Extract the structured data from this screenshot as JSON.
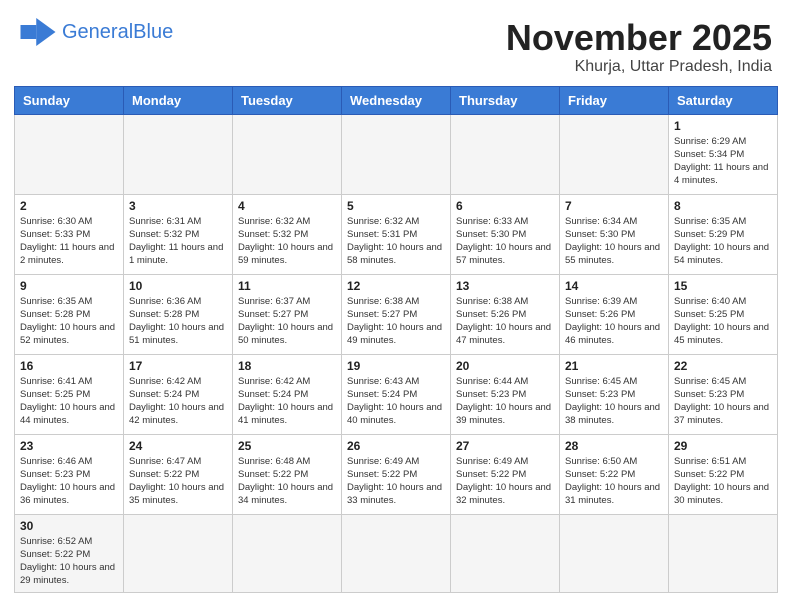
{
  "header": {
    "logo_general": "General",
    "logo_blue": "Blue",
    "month": "November 2025",
    "location": "Khurja, Uttar Pradesh, India"
  },
  "days_of_week": [
    "Sunday",
    "Monday",
    "Tuesday",
    "Wednesday",
    "Thursday",
    "Friday",
    "Saturday"
  ],
  "weeks": [
    [
      {
        "day": "",
        "empty": true
      },
      {
        "day": "",
        "empty": true
      },
      {
        "day": "",
        "empty": true
      },
      {
        "day": "",
        "empty": true
      },
      {
        "day": "",
        "empty": true
      },
      {
        "day": "",
        "empty": true
      },
      {
        "day": "1",
        "sunrise": "6:29 AM",
        "sunset": "5:34 PM",
        "daylight": "11 hours and 4 minutes."
      }
    ],
    [
      {
        "day": "2",
        "sunrise": "6:30 AM",
        "sunset": "5:33 PM",
        "daylight": "11 hours and 2 minutes."
      },
      {
        "day": "3",
        "sunrise": "6:31 AM",
        "sunset": "5:32 PM",
        "daylight": "11 hours and 1 minute."
      },
      {
        "day": "4",
        "sunrise": "6:32 AM",
        "sunset": "5:32 PM",
        "daylight": "10 hours and 59 minutes."
      },
      {
        "day": "5",
        "sunrise": "6:32 AM",
        "sunset": "5:31 PM",
        "daylight": "10 hours and 58 minutes."
      },
      {
        "day": "6",
        "sunrise": "6:33 AM",
        "sunset": "5:30 PM",
        "daylight": "10 hours and 57 minutes."
      },
      {
        "day": "7",
        "sunrise": "6:34 AM",
        "sunset": "5:30 PM",
        "daylight": "10 hours and 55 minutes."
      },
      {
        "day": "8",
        "sunrise": "6:35 AM",
        "sunset": "5:29 PM",
        "daylight": "10 hours and 54 minutes."
      }
    ],
    [
      {
        "day": "9",
        "sunrise": "6:35 AM",
        "sunset": "5:28 PM",
        "daylight": "10 hours and 52 minutes."
      },
      {
        "day": "10",
        "sunrise": "6:36 AM",
        "sunset": "5:28 PM",
        "daylight": "10 hours and 51 minutes."
      },
      {
        "day": "11",
        "sunrise": "6:37 AM",
        "sunset": "5:27 PM",
        "daylight": "10 hours and 50 minutes."
      },
      {
        "day": "12",
        "sunrise": "6:38 AM",
        "sunset": "5:27 PM",
        "daylight": "10 hours and 49 minutes."
      },
      {
        "day": "13",
        "sunrise": "6:38 AM",
        "sunset": "5:26 PM",
        "daylight": "10 hours and 47 minutes."
      },
      {
        "day": "14",
        "sunrise": "6:39 AM",
        "sunset": "5:26 PM",
        "daylight": "10 hours and 46 minutes."
      },
      {
        "day": "15",
        "sunrise": "6:40 AM",
        "sunset": "5:25 PM",
        "daylight": "10 hours and 45 minutes."
      }
    ],
    [
      {
        "day": "16",
        "sunrise": "6:41 AM",
        "sunset": "5:25 PM",
        "daylight": "10 hours and 44 minutes."
      },
      {
        "day": "17",
        "sunrise": "6:42 AM",
        "sunset": "5:24 PM",
        "daylight": "10 hours and 42 minutes."
      },
      {
        "day": "18",
        "sunrise": "6:42 AM",
        "sunset": "5:24 PM",
        "daylight": "10 hours and 41 minutes."
      },
      {
        "day": "19",
        "sunrise": "6:43 AM",
        "sunset": "5:24 PM",
        "daylight": "10 hours and 40 minutes."
      },
      {
        "day": "20",
        "sunrise": "6:44 AM",
        "sunset": "5:23 PM",
        "daylight": "10 hours and 39 minutes."
      },
      {
        "day": "21",
        "sunrise": "6:45 AM",
        "sunset": "5:23 PM",
        "daylight": "10 hours and 38 minutes."
      },
      {
        "day": "22",
        "sunrise": "6:45 AM",
        "sunset": "5:23 PM",
        "daylight": "10 hours and 37 minutes."
      }
    ],
    [
      {
        "day": "23",
        "sunrise": "6:46 AM",
        "sunset": "5:23 PM",
        "daylight": "10 hours and 36 minutes."
      },
      {
        "day": "24",
        "sunrise": "6:47 AM",
        "sunset": "5:22 PM",
        "daylight": "10 hours and 35 minutes."
      },
      {
        "day": "25",
        "sunrise": "6:48 AM",
        "sunset": "5:22 PM",
        "daylight": "10 hours and 34 minutes."
      },
      {
        "day": "26",
        "sunrise": "6:49 AM",
        "sunset": "5:22 PM",
        "daylight": "10 hours and 33 minutes."
      },
      {
        "day": "27",
        "sunrise": "6:49 AM",
        "sunset": "5:22 PM",
        "daylight": "10 hours and 32 minutes."
      },
      {
        "day": "28",
        "sunrise": "6:50 AM",
        "sunset": "5:22 PM",
        "daylight": "10 hours and 31 minutes."
      },
      {
        "day": "29",
        "sunrise": "6:51 AM",
        "sunset": "5:22 PM",
        "daylight": "10 hours and 30 minutes."
      }
    ],
    [
      {
        "day": "30",
        "sunrise": "6:52 AM",
        "sunset": "5:22 PM",
        "daylight": "10 hours and 29 minutes."
      },
      {
        "day": "",
        "empty": true
      },
      {
        "day": "",
        "empty": true
      },
      {
        "day": "",
        "empty": true
      },
      {
        "day": "",
        "empty": true
      },
      {
        "day": "",
        "empty": true
      },
      {
        "day": "",
        "empty": true
      }
    ]
  ]
}
